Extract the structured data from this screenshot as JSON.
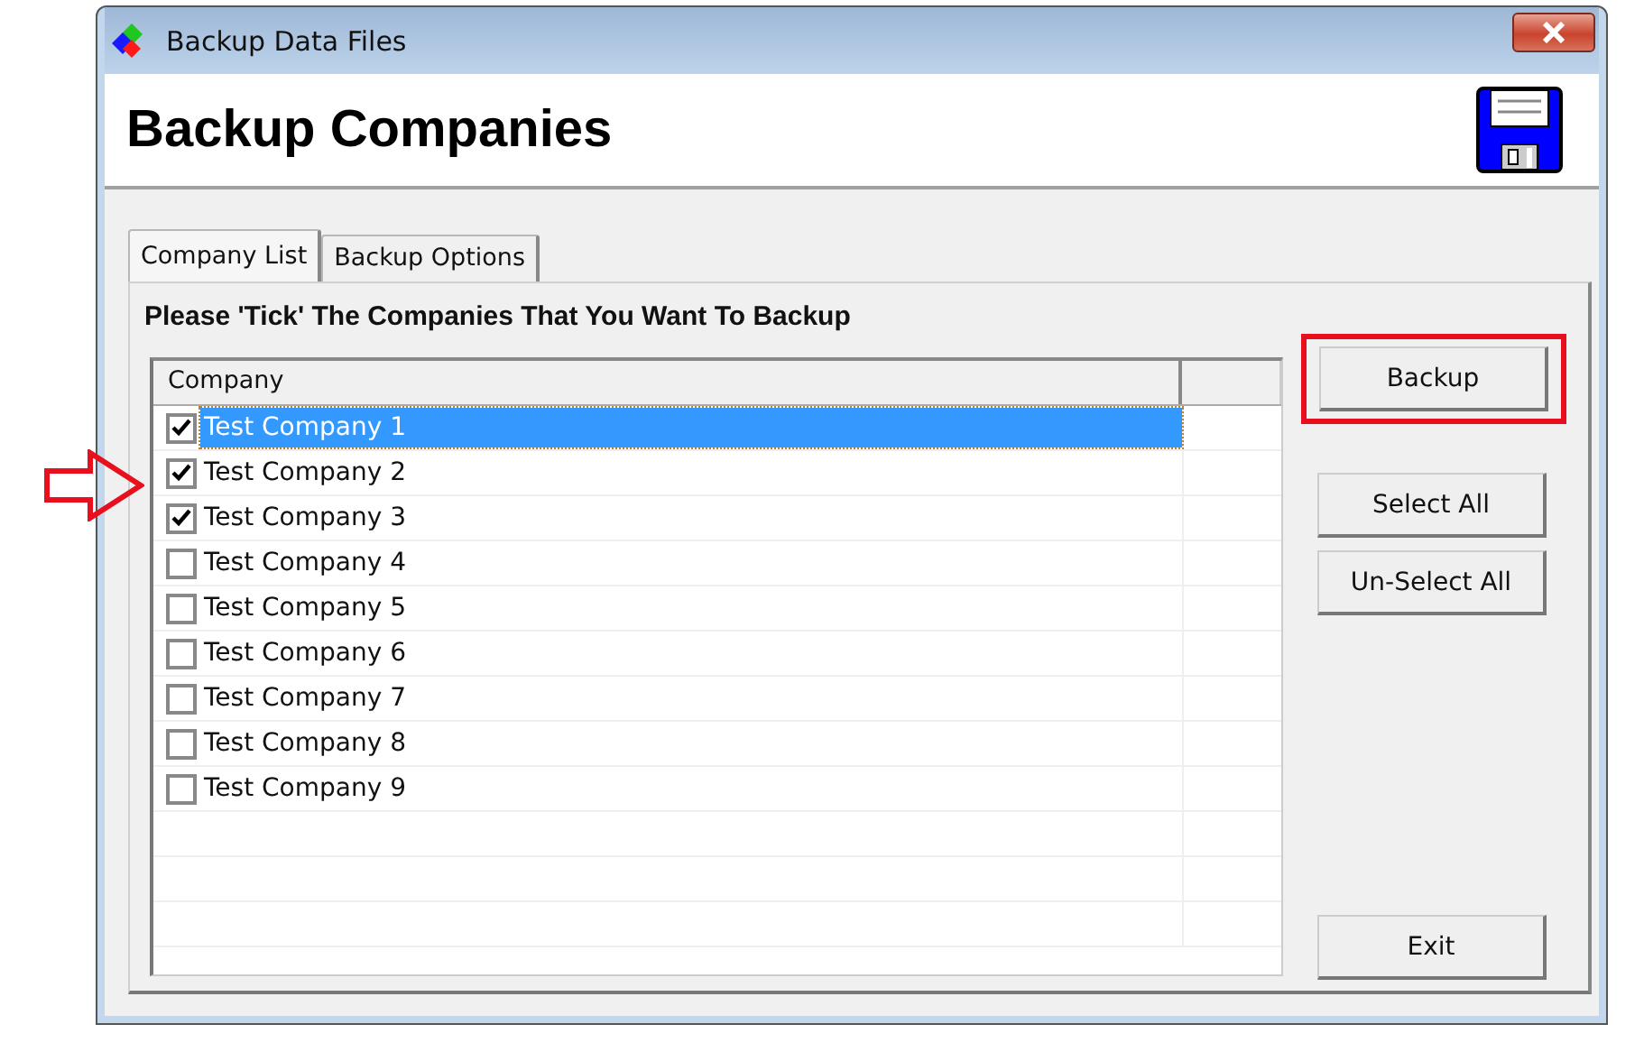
{
  "window": {
    "title": "Backup Data Files"
  },
  "header": {
    "title": "Backup Companies"
  },
  "tabs": [
    {
      "label": "Company List",
      "selected": true
    },
    {
      "label": "Backup Options",
      "selected": false
    }
  ],
  "instruction": "Please 'Tick' The Companies That You Want To Backup",
  "table": {
    "columns": [
      "Company"
    ],
    "rows": [
      {
        "name": "Test Company 1",
        "checked": true,
        "selected": true,
        "marked": false
      },
      {
        "name": "Test Company 2",
        "checked": true,
        "selected": false,
        "marked": true
      },
      {
        "name": "Test Company 3",
        "checked": true,
        "selected": false,
        "marked": false
      },
      {
        "name": "Test Company 4",
        "checked": false,
        "selected": false,
        "marked": false
      },
      {
        "name": "Test Company 5",
        "checked": false,
        "selected": false,
        "marked": false
      },
      {
        "name": "Test Company 6",
        "checked": false,
        "selected": false,
        "marked": false
      },
      {
        "name": "Test Company 7",
        "checked": false,
        "selected": false,
        "marked": false
      },
      {
        "name": "Test Company 8",
        "checked": false,
        "selected": false,
        "marked": false
      },
      {
        "name": "Test Company 9",
        "checked": false,
        "selected": false,
        "marked": false
      }
    ]
  },
  "buttons": [
    {
      "label": "Backup",
      "highlighted": true,
      "kind": "top"
    },
    {
      "label": "Select All",
      "highlighted": false,
      "kind": "middle"
    },
    {
      "label": "Un-Select All",
      "highlighted": false,
      "kind": "middle"
    },
    {
      "label": "Exit",
      "highlighted": false,
      "kind": "bottom"
    }
  ]
}
